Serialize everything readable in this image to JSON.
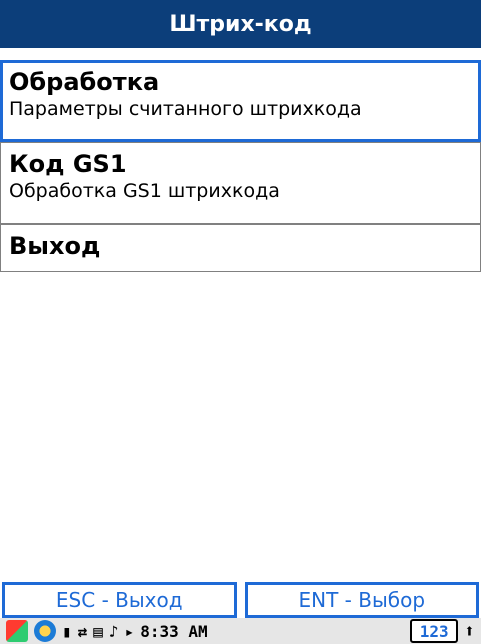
{
  "window": {
    "title": "Штрих-код"
  },
  "menu": {
    "items": [
      {
        "title": "Обработка",
        "subtitle": "Параметры считанного штрихкода",
        "selected": true
      },
      {
        "title": "Код GS1",
        "subtitle": "Обработка GS1 штрихкода",
        "selected": false
      },
      {
        "title": "Выход",
        "subtitle": "",
        "selected": false
      }
    ]
  },
  "softkeys": {
    "left": "ESC - Выход",
    "right": "ENT - Выбор"
  },
  "taskbar": {
    "time": "8:33 AM",
    "keyboard": "123"
  },
  "colors": {
    "title_bg": "#0c3e7a",
    "accent": "#1e6ad6"
  }
}
